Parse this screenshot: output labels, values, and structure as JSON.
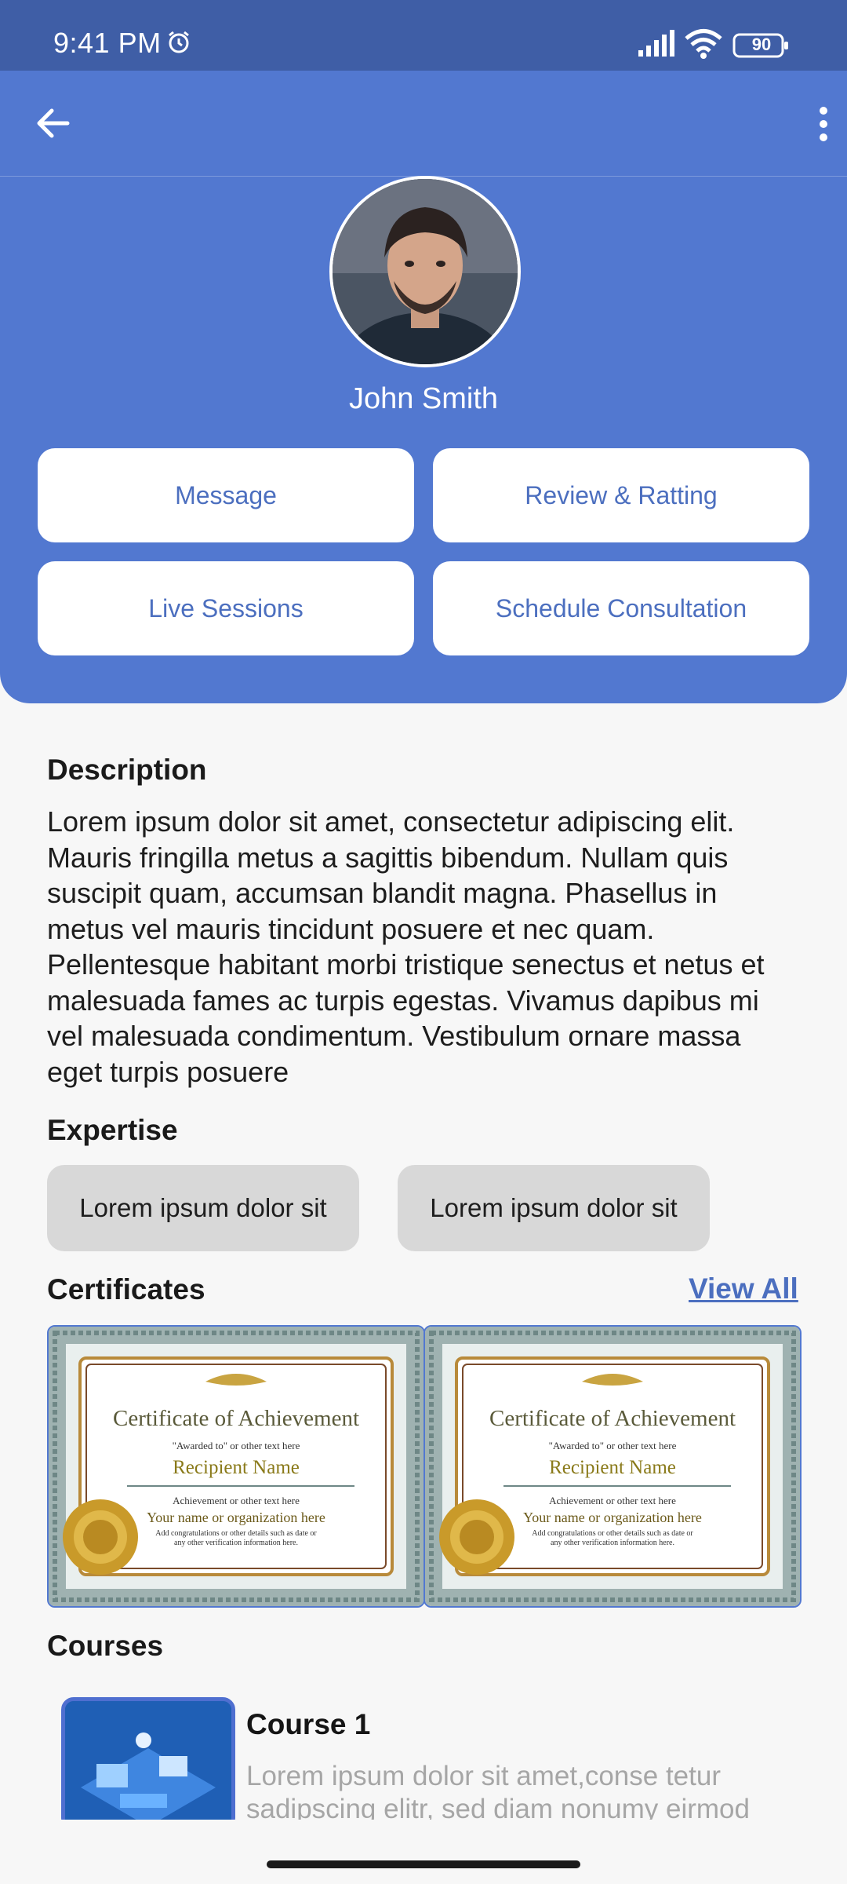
{
  "status_bar": {
    "time": "9:41 PM",
    "battery": "90"
  },
  "profile": {
    "name": "John Smith"
  },
  "actions": {
    "message": "Message",
    "review": "Review & Ratting",
    "live_sessions": "Live Sessions",
    "schedule": "Schedule Consultation"
  },
  "description": {
    "title": "Description",
    "text": "Lorem ipsum dolor sit amet, consectetur adipiscing elit. Mauris fringilla metus a sagittis bibendum. Nullam quis suscipit quam, accumsan blandit magna. Phasellus in metus vel mauris tincidunt posuere et nec quam. Pellentesque habitant morbi tristique senectus et netus et malesuada fames ac turpis egestas. Vivamus dapibus mi vel malesuada condimentum. Vestibulum ornare massa eget turpis posuere"
  },
  "expertise": {
    "title": "Expertise",
    "items": [
      "Lorem ipsum dolor sit",
      "Lorem ipsum dolor sit"
    ]
  },
  "certificates": {
    "title": "Certificates",
    "view_all": "View All",
    "items": [
      {
        "heading": "Certificate of Achievement",
        "awarded": "\"Awarded to\" or other text here",
        "recipient": "Recipient Name",
        "achievement": "Achievement or other text here",
        "org": "Your name or organization here",
        "note1": "Add congratulations or other details such as date or",
        "note2": "any other verification information here."
      },
      {
        "heading": "Certificate of Achievement",
        "awarded": "\"Awarded to\" or other text here",
        "recipient": "Recipient Name",
        "achievement": "Achievement or other text here",
        "org": "Your name or organization here",
        "note1": "Add congratulations or other details such as date or",
        "note2": "any other verification information here."
      }
    ]
  },
  "courses": {
    "title": "Courses",
    "items": [
      {
        "title": "Course 1",
        "desc": "Lorem ipsum dolor sit amet,conse tetur sadipscing elitr, sed diam nonumy eirmod"
      }
    ]
  },
  "colors": {
    "primary": "#5278d0",
    "status": "#3f5ea6",
    "accent_text": "#4c6fbf"
  }
}
